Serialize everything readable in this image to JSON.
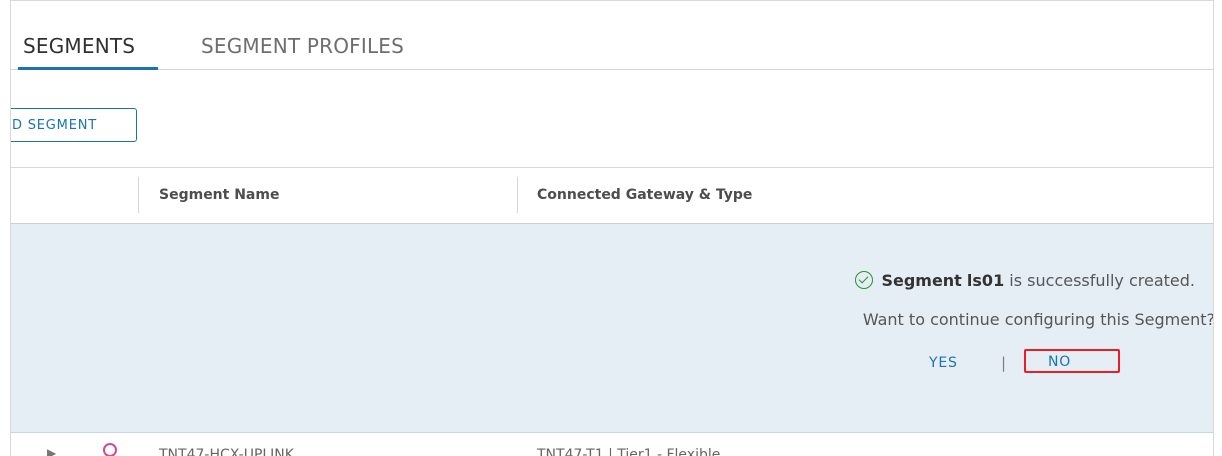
{
  "tabs": [
    {
      "label": "SEGMENTS",
      "active": true
    },
    {
      "label": "SEGMENT PROFILES",
      "active": false
    }
  ],
  "toolbar": {
    "add_segment_label": "D SEGMENT"
  },
  "table": {
    "columns": [
      "Segment Name",
      "Connected Gateway & Type"
    ]
  },
  "notification": {
    "segment_word": "Segment",
    "segment_name": "ls01",
    "success_suffix": "is successfully created.",
    "question": "Want to continue configuring this Segment?",
    "yes_label": "YES",
    "separator": "|",
    "no_label": "NO"
  },
  "first_row": {
    "segment_name": "TNT47-HCX-UPLINK",
    "gateway": "TNT47-T1 | Tier1 - Flexible"
  },
  "colors": {
    "accent": "#1b73b4",
    "highlight": "#ee1c25",
    "success": "#2f8e3a",
    "notice_bg": "#e6eef5"
  }
}
